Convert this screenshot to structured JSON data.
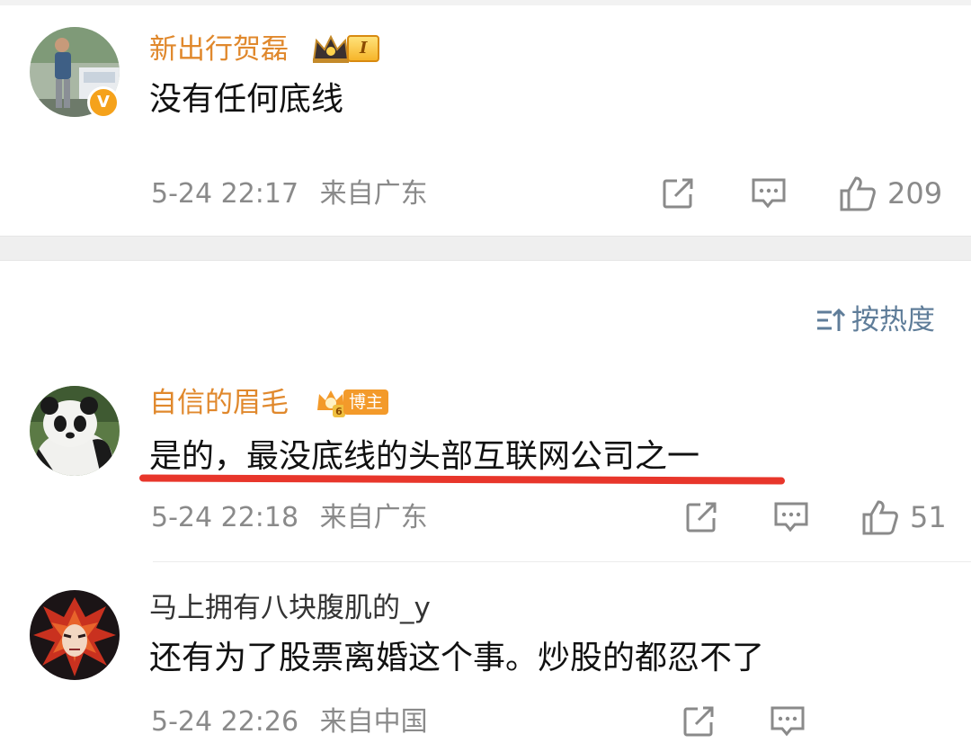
{
  "sort": {
    "label": "按热度",
    "icon": "sort-icon"
  },
  "comments": [
    {
      "username": "新出行贺磊",
      "username_color": "#e0882c",
      "badge": {
        "type": "crown-level",
        "level": "I"
      },
      "verified": true,
      "text": "没有任何底线",
      "time": "5-24 22:17",
      "location": "来自广东",
      "likes": "209",
      "icons": [
        "share-icon",
        "comment-icon",
        "like-icon"
      ]
    },
    {
      "username": "自信的眉毛",
      "username_color": "#e0882c",
      "badge": {
        "type": "blogger",
        "label": "博主",
        "level": "6"
      },
      "verified": false,
      "text": "是的，最没底线的头部互联网公司之一",
      "time": "5-24 22:18",
      "location": "来自广东",
      "likes": "51",
      "icons": [
        "share-icon",
        "comment-icon",
        "like-icon"
      ],
      "highlight_color": "#e8362b"
    },
    {
      "username": "马上拥有八块腹肌的_y",
      "username_color": "#333333",
      "verified": false,
      "text": "还有为了股票离婚这个事。炒股的都忍不了",
      "time": "5-24 22:26",
      "location": "来自中国",
      "likes": "",
      "icons": [
        "share-icon",
        "comment-icon"
      ]
    }
  ],
  "colors": {
    "accent_orange": "#e0882c",
    "meta_gray": "#8a8a8a",
    "sort_blue": "#5f7d99",
    "separator": "#efefef"
  }
}
